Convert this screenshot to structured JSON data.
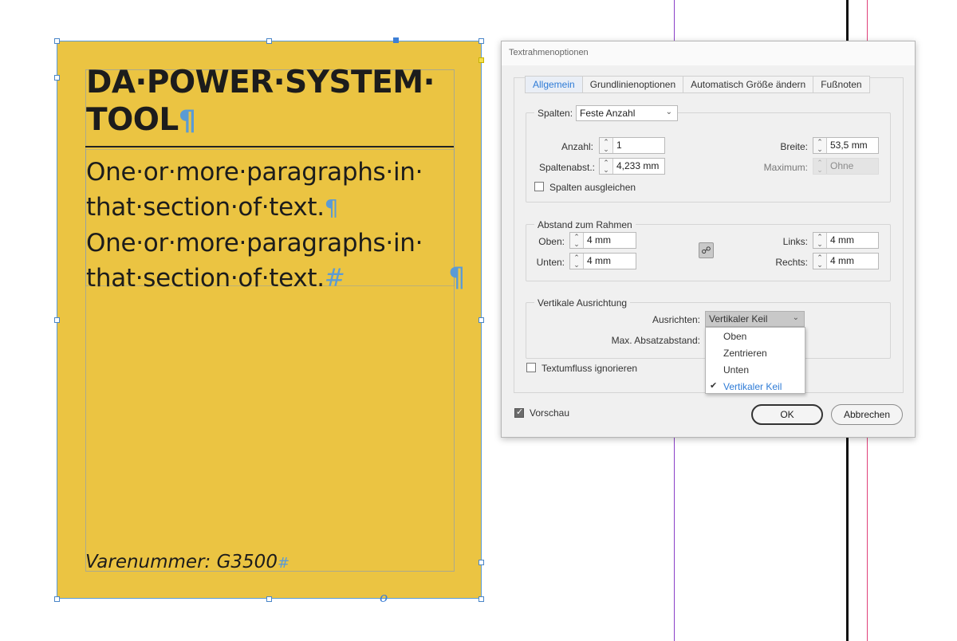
{
  "canvas": {
    "title_line1": "DA·POWER·SYSTEM·",
    "title_line2": "TOOL",
    "pilcrow": "¶",
    "body_line1": "One·or·more·paragraphs·in·",
    "body_line2": "that·section·of·text.",
    "body_line3": "One·or·more·paragraphs·in·",
    "body_line4": "that·section·of·text.",
    "end_mark": "#",
    "stray_pilcrow": "¶",
    "sku": "Varenummer: G3500",
    "sku_end": "#",
    "overflow_mark": "o",
    "frame_color": "#ebc442"
  },
  "dialog": {
    "title": "Textrahmenoptionen",
    "tabs": [
      {
        "label": "Allgemein",
        "active": true
      },
      {
        "label": "Grundlinienoptionen",
        "active": false
      },
      {
        "label": "Automatisch Größe ändern",
        "active": false
      },
      {
        "label": "Fußnoten",
        "active": false
      }
    ],
    "columns": {
      "label": "Spalten:",
      "type_value": "Feste Anzahl",
      "count_label": "Anzahl:",
      "count_value": "1",
      "gutter_label": "Spaltenabst.:",
      "gutter_value": "4,233 mm",
      "width_label": "Breite:",
      "width_value": "53,5 mm",
      "max_label": "Maximum:",
      "max_value": "Ohne",
      "balance_label": "Spalten ausgleichen"
    },
    "inset": {
      "group_label": "Abstand zum Rahmen",
      "top_label": "Oben:",
      "top_value": "4 mm",
      "bottom_label": "Unten:",
      "bottom_value": "4 mm",
      "left_label": "Links:",
      "left_value": "4 mm",
      "right_label": "Rechts:",
      "right_value": "4 mm",
      "link_icon": "chain-link-icon"
    },
    "vertical": {
      "group_label": "Vertikale Ausrichtung",
      "align_label": "Ausrichten:",
      "align_value": "Vertikaler Keil",
      "max_spacing_label": "Max. Absatzabstand:",
      "options": [
        "Oben",
        "Zentrieren",
        "Unten",
        "Vertikaler Keil"
      ],
      "selected": "Vertikaler Keil"
    },
    "ignore_wrap_label": "Textumfluss ignorieren",
    "preview_label": "Vorschau",
    "ok_label": "OK",
    "cancel_label": "Abbrechen",
    "accent": "#2e7bd6"
  }
}
